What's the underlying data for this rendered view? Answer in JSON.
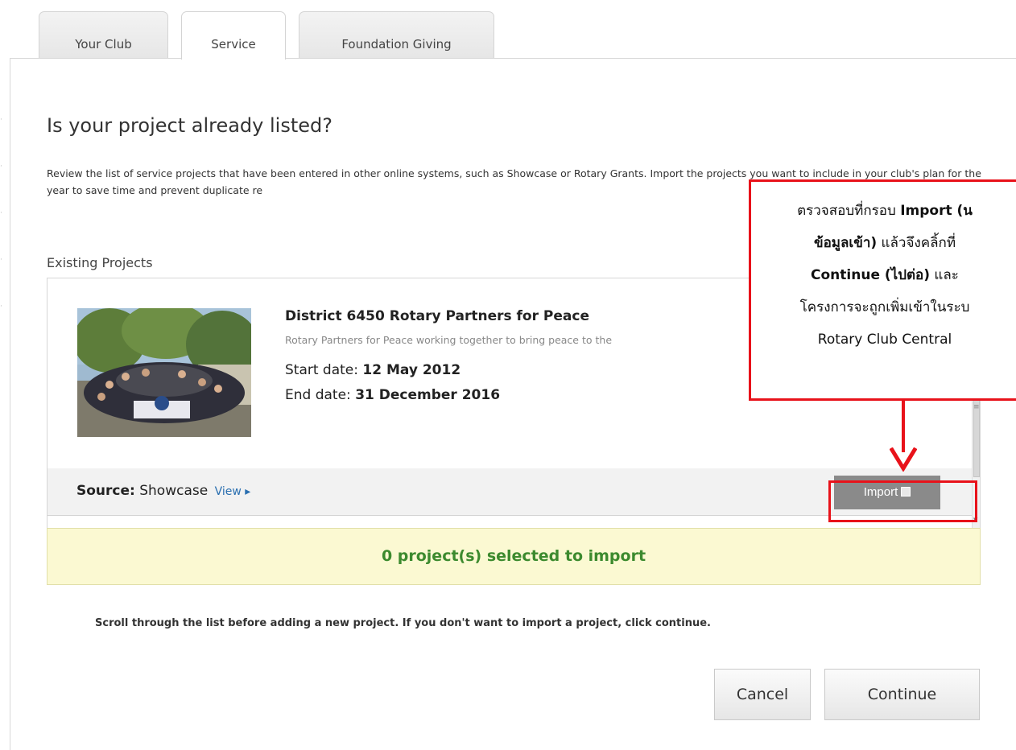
{
  "tabs": [
    {
      "label": "Your Club",
      "active": false
    },
    {
      "label": "Service",
      "active": true
    },
    {
      "label": "Foundation Giving",
      "active": false
    }
  ],
  "page": {
    "title": "Is your project already listed?",
    "intro": "Review the list of service projects that have been entered in other online systems, such as Showcase or Rotary Grants. Import the projects you want to include in your club's plan for the year to save time and prevent duplicate re"
  },
  "existing": {
    "title": "Existing Projects",
    "project": {
      "name": "District 6450 Rotary Partners for Peace",
      "description": "Rotary Partners for Peace working together to bring peace to the",
      "start_label": "Start date:",
      "start_value": "12 May 2012",
      "end_label": "End date:",
      "end_value": "31 December 2016",
      "source_label": "Source:",
      "source_value": "Showcase",
      "view_label": "View ▸",
      "import_label": "Import"
    }
  },
  "selected_count": "0 project(s) selected to import",
  "scroll_note": "Scroll through the list before adding a new project. If you don't want to import a project, click continue.",
  "buttons": {
    "cancel": "Cancel",
    "continue": "Continue"
  },
  "annotation": {
    "line1_prefix": "ตรวจสอบที่กรอบ ",
    "line1_bold": "Import (น",
    "line2_bold": "ข้อมูลเข้า)",
    "line2_rest": " แล้วจึงคลิ้กที่",
    "line3_bold": "Continue (ไปต่อ)",
    "line3_rest": " และ",
    "line4": "โครงการจะถูกเพิ่มเข้าในระบ",
    "line5": "Rotary Club Central"
  },
  "colors": {
    "annotation_red": "#e8121a",
    "selected_bar_bg": "#fbf9d2",
    "selected_text": "#3c8a2e",
    "link": "#2a6fb0",
    "import_button": "#8a8a8a"
  }
}
